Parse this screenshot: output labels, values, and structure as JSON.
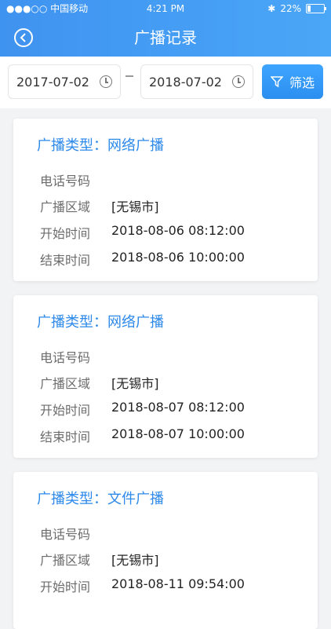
{
  "status_bar": {
    "carrier": "●●●○○ 中国移动",
    "time": "4:21 PM",
    "battery": "22%"
  },
  "header": {
    "title": "广播记录"
  },
  "filter": {
    "start_date": "2017-07-02",
    "end_date": "2018-07-02",
    "filter_label": "筛选"
  },
  "records": [
    {
      "type_label": "广播类型：网络广播",
      "phone_label": "电话号码",
      "phone_value": "",
      "area_label": "广播区域",
      "area_value": "[无锡市]",
      "start_label": "开始时间",
      "start_value": "2018-08-06  08:12:00",
      "end_label": "结束时间",
      "end_value": "2018-08-06  10:00:00"
    },
    {
      "type_label": "广播类型：网络广播",
      "phone_label": "电话号码",
      "phone_value": "",
      "area_label": "广播区域",
      "area_value": "[无锡市]",
      "start_label": "开始时间",
      "start_value": "2018-08-07  08:12:00",
      "end_label": "结束时间",
      "end_value": "2018-08-07  10:00:00"
    },
    {
      "type_label": "广播类型：文件广播",
      "phone_label": "电话号码",
      "phone_value": "",
      "area_label": "广播区域",
      "area_value": "[无锡市]",
      "start_label": "开始时间",
      "start_value": "2018-08-11  09:54:00"
    }
  ],
  "colors": {
    "accent": "#2d89ea",
    "header_gradient_start": "#3f93f0",
    "header_gradient_end": "#4aa6f7"
  }
}
